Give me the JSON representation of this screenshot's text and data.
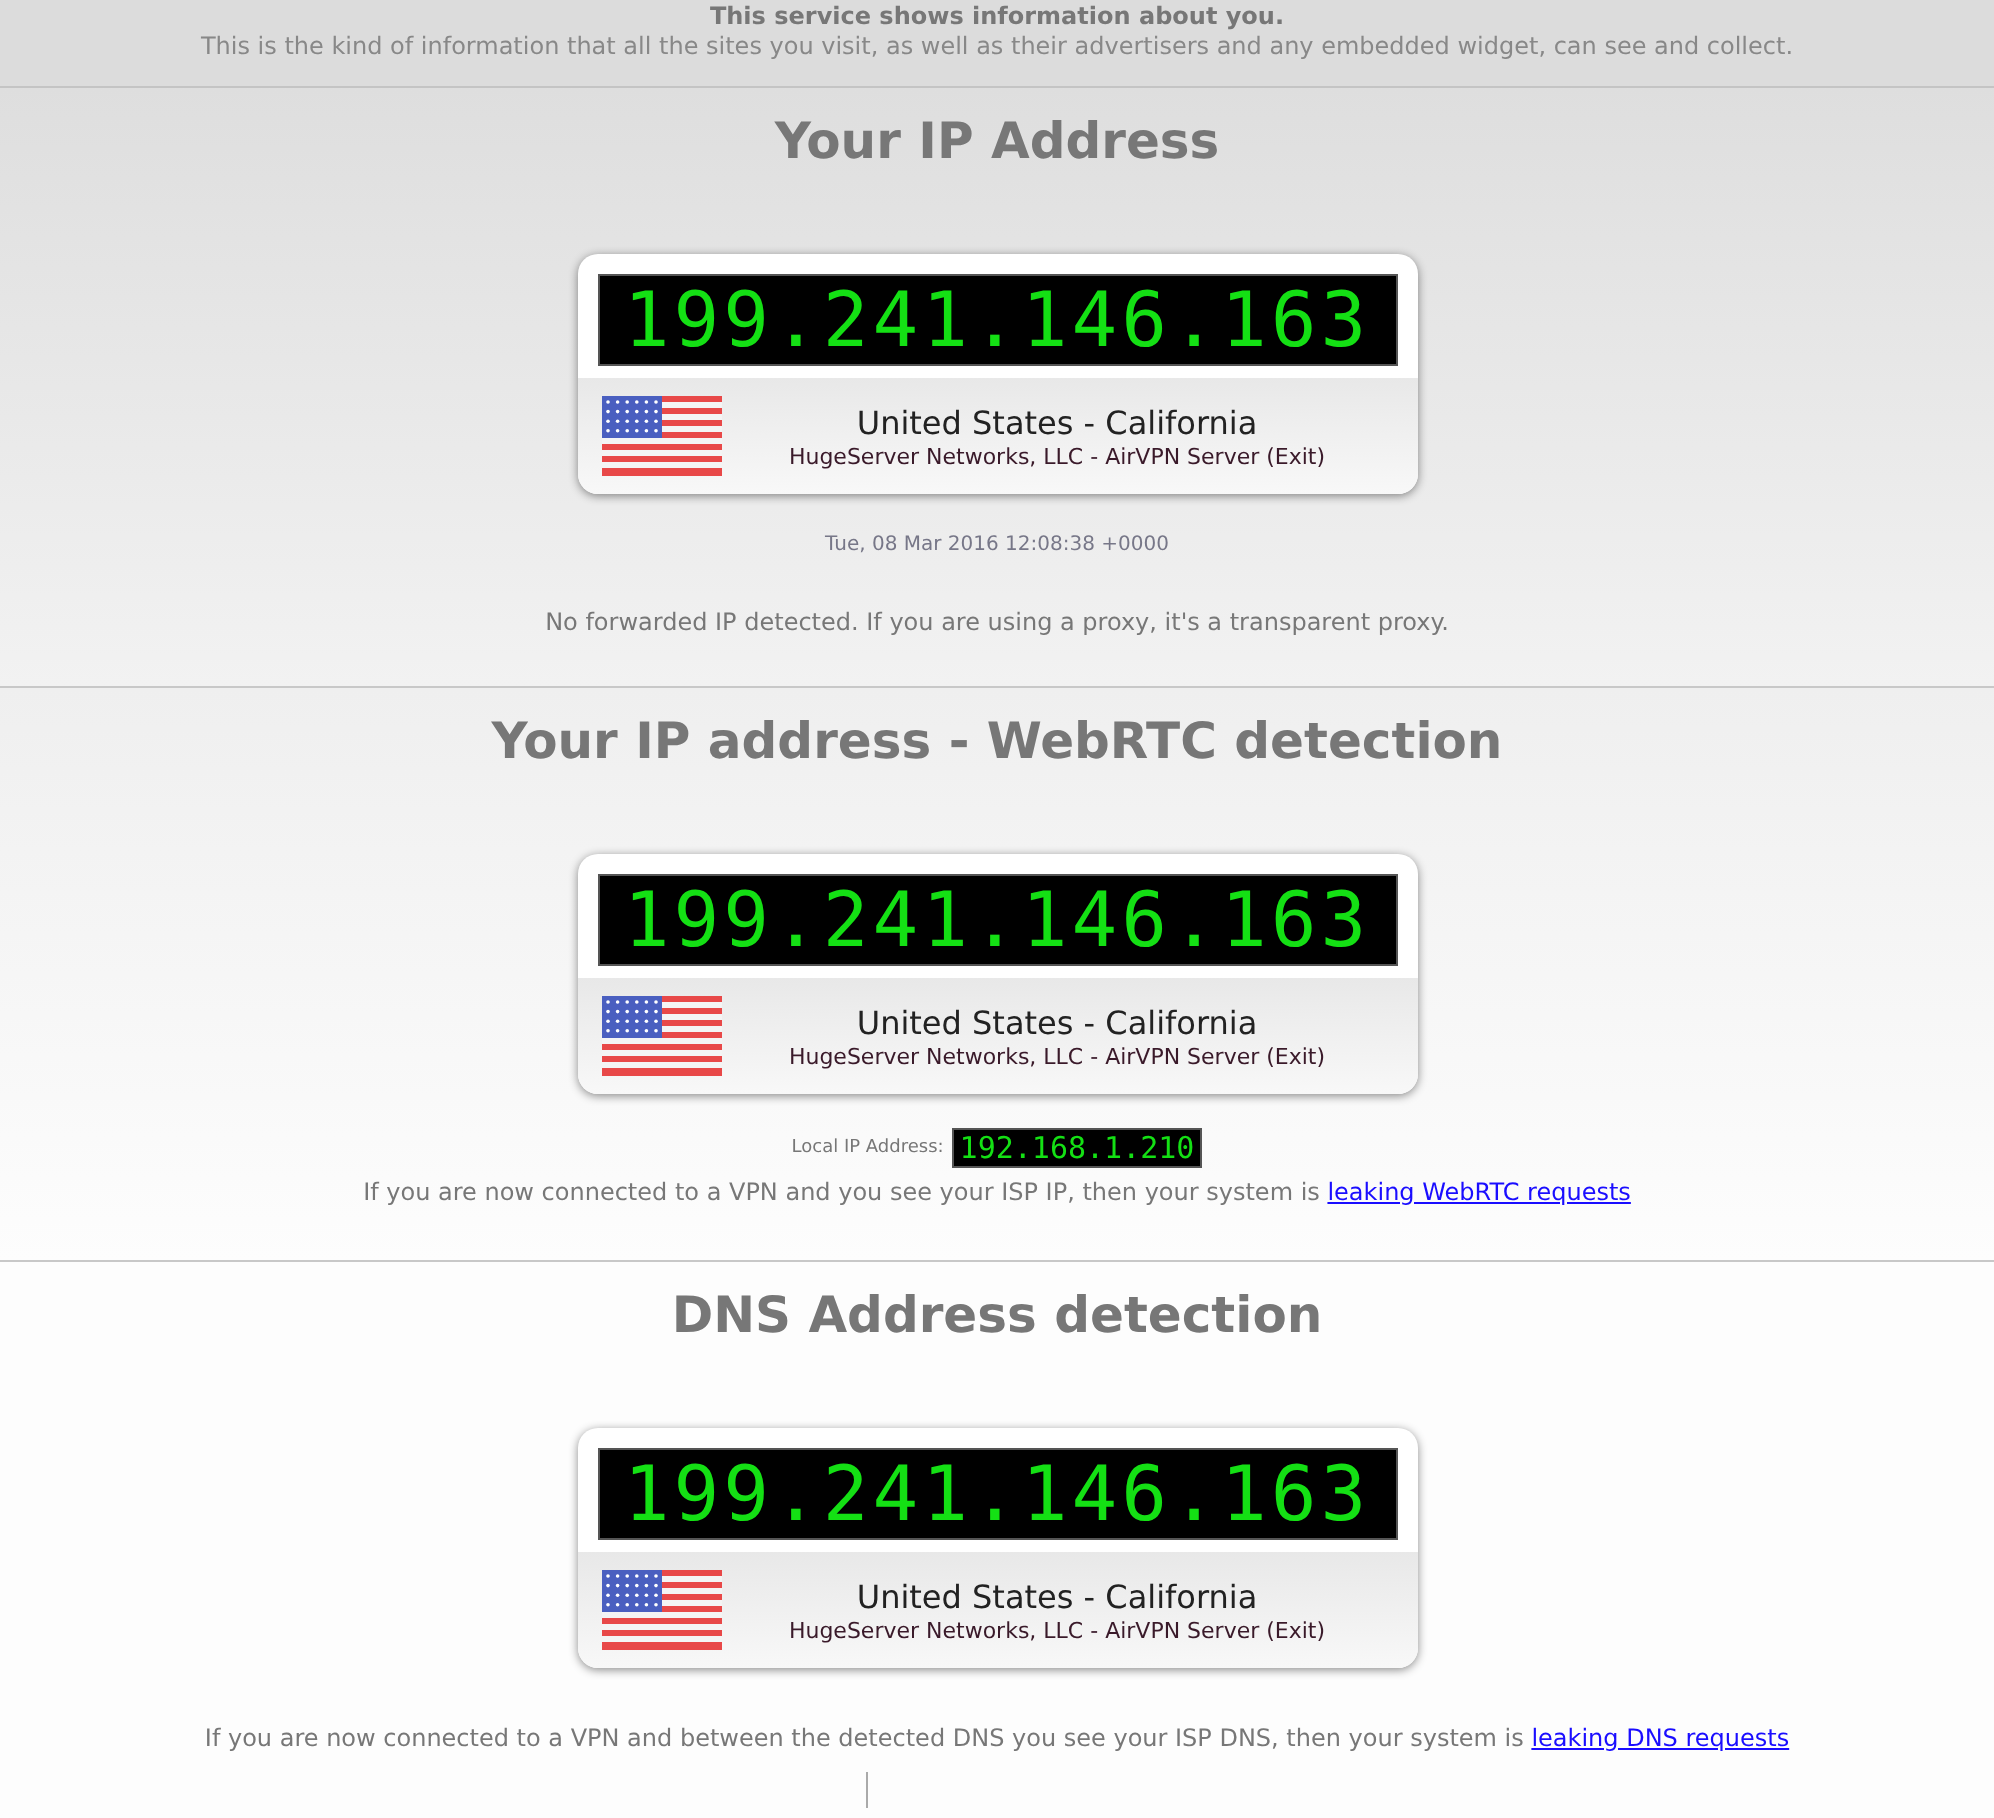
{
  "header": {
    "title": "This service shows information about you.",
    "subtitle": "This is the kind of information that all the sites you visit, as well as their advertisers and any embedded widget, can see and collect."
  },
  "sections": [
    {
      "kind": "ip",
      "title": "Your IP Address",
      "card": {
        "ip": "199.241.146.163",
        "location": "United States - California",
        "isp": "HugeServer Networks, LLC - AirVPN Server (Exit)"
      },
      "timestamp": "Tue, 08 Mar 2016 12:08:38 +0000",
      "note": "No forwarded IP detected. If you are using a proxy, it's a transparent proxy."
    },
    {
      "kind": "webrtc",
      "title": "Your IP address - WebRTC detection",
      "card": {
        "ip": "199.241.146.163",
        "location": "United States - California",
        "isp": "HugeServer Networks, LLC - AirVPN Server (Exit)"
      },
      "local_ip": {
        "label": "Local IP Address:",
        "value": "192.168.1.210"
      },
      "notice": {
        "text": "If you are now connected to a VPN and you see your ISP IP, then your system is",
        "link": "leaking WebRTC requests"
      }
    },
    {
      "kind": "dns",
      "title": "DNS Address detection",
      "card": {
        "ip": "199.241.146.163",
        "location": "United States - California",
        "isp": "HugeServer Networks, LLC - AirVPN Server (Exit)"
      },
      "notice": {
        "text": "If you are now connected to a VPN and between the detected DNS you see your ISP DNS, then your system is",
        "link": "leaking DNS requests"
      }
    }
  ]
}
